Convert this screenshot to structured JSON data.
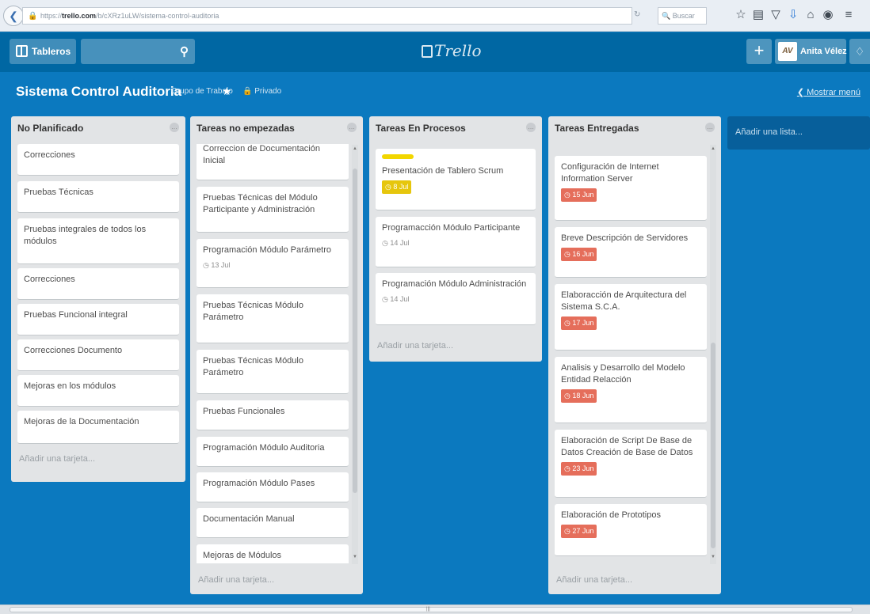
{
  "browser": {
    "url_prefix": "https://",
    "url_host": "trello.com",
    "url_path": "/b/cXRz1uLW/sistema-control-auditoria",
    "search_placeholder": "Buscar",
    "reload_icon": "reload-icon",
    "icons": [
      "star-icon",
      "clipboard-icon",
      "pocket-icon",
      "download-icon",
      "home-icon",
      "sync-icon",
      "hamburger-menu-icon"
    ]
  },
  "header": {
    "boards_label": "Tableros",
    "logo_text": "Trello",
    "user_initials": "AV",
    "user_name": "Anita Vélez"
  },
  "board": {
    "title": "Sistema Control Auditoria",
    "team": "Grupo de Trabajo",
    "visibility": "Privado",
    "show_menu": "Mostrar menú",
    "add_list": "Añadir una lista..."
  },
  "lists": [
    {
      "title": "No Planificado",
      "add_card": "Añadir una tarjeta...",
      "cards": [
        {
          "title": "Correcciones"
        },
        {
          "title": "Pruebas Técnicas"
        },
        {
          "title": "Pruebas integrales de todos los módulos"
        },
        {
          "title": "Correcciones"
        },
        {
          "title": "Pruebas Funcional integral"
        },
        {
          "title": "Correcciones Documento"
        },
        {
          "title": "Mejoras en los módulos"
        },
        {
          "title": "Mejoras de la Documentación"
        }
      ]
    },
    {
      "title": "Tareas no empezadas",
      "add_card": "Añadir una tarjeta...",
      "cards": [
        {
          "title": "Correccion de Documentación Inicial"
        },
        {
          "title": "Pruebas Técnicas del Módulo Participante y Administración"
        },
        {
          "title": "Programación Módulo Parámetro",
          "due": "13 Jul"
        },
        {
          "title": "Pruebas Técnicas Módulo Parámetro"
        },
        {
          "title": "Pruebas Técnicas Módulo Parámetro"
        },
        {
          "title": "Pruebas Funcionales"
        },
        {
          "title": "Programación Módulo Auditoria"
        },
        {
          "title": "Programación Módulo Pases"
        },
        {
          "title": "Documentación Manual"
        },
        {
          "title": "Mejoras de Módulos"
        }
      ]
    },
    {
      "title": "Tareas En Procesos",
      "add_card": "Añadir una tarjeta...",
      "cards": [
        {
          "title": "Presentación de Tablero Scrum",
          "due": "8 Jul",
          "label_color": "#f2d600"
        },
        {
          "title": "Programacción Módulo Participante",
          "due": "14 Jul"
        },
        {
          "title": "Programación Módulo Administración",
          "due": "14 Jul"
        }
      ]
    },
    {
      "title": "Tareas Entregadas",
      "add_card": "Añadir una tarjeta...",
      "cards": [
        {
          "title": "Configuración de Internet Information Server",
          "due": "15 Jun"
        },
        {
          "title": "Breve Descripción de Servidores",
          "due": "16 Jun"
        },
        {
          "title": "Elaboracción de Arquitectura del Sistema S.C.A.",
          "due": "17 Jun"
        },
        {
          "title": "Analisis y Desarrollo del Modelo Entidad Relacción",
          "due": "18 Jun"
        },
        {
          "title": "Elaboración de Script De Base de Datos Creación de Base de Datos",
          "due": "23 Jun"
        },
        {
          "title": "Elaboración de Prototipos",
          "due": "27 Jun"
        }
      ]
    }
  ],
  "colors": {
    "board_bg": "#0b79bf",
    "header_bg": "#0067a3",
    "list_bg": "#e2e4e6",
    "overdue": "#e56e5b",
    "due_soon": "#e6c60d"
  }
}
